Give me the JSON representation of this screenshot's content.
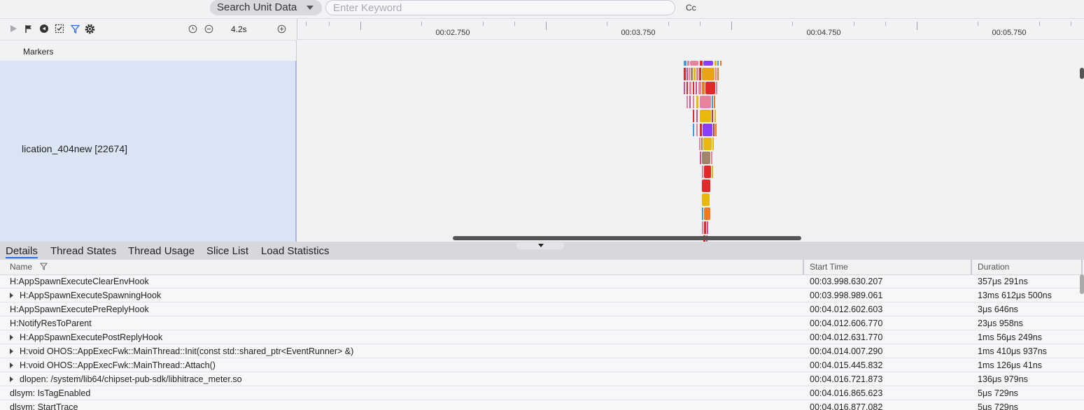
{
  "search": {
    "scope_label": "Search Unit Data",
    "placeholder": "Enter Keyword",
    "value": "",
    "case_button": "Cc"
  },
  "toolbar": {
    "icons": [
      "play-icon",
      "flag-icon",
      "marker-circle-icon",
      "capture-icon",
      "filter-icon",
      "settings-icon"
    ],
    "zoom_value": "4.2s"
  },
  "ruler": {
    "labels": [
      "00:02.750",
      "00:03.750",
      "00:04.750",
      "00:05.750"
    ]
  },
  "markers_label": "Markers",
  "process": {
    "name": "lication_404new [22674]"
  },
  "slice_colors": [
    "#e8a317",
    "#8a3ffc",
    "#e0292b",
    "#e7829b",
    "#e8b80c",
    "#f07a1e",
    "#3f9be0",
    "#a0856b",
    "#d14f8c",
    "#20a0a0"
  ],
  "tabs": [
    "Details",
    "Thread States",
    "Thread Usage",
    "Slice List",
    "Load Statistics"
  ],
  "active_tab": "Details",
  "table": {
    "headers": {
      "name": "Name",
      "start": "Start Time",
      "duration": "Duration"
    },
    "rows": [
      {
        "name": "H:AppSpawnExecuteClearEnvHook",
        "expandable": false,
        "start": "00:03.998.630.207",
        "duration": "357μs 291ns"
      },
      {
        "name": "H:AppSpawnExecuteSpawningHook",
        "expandable": true,
        "start": "00:03.998.989.061",
        "duration": "13ms 612μs 500ns"
      },
      {
        "name": "H:AppSpawnExecutePreReplyHook",
        "expandable": false,
        "start": "00:04.012.602.603",
        "duration": "3μs 646ns"
      },
      {
        "name": "H:NotifyResToParent",
        "expandable": false,
        "start": "00:04.012.606.770",
        "duration": "23μs 958ns"
      },
      {
        "name": "H:AppSpawnExecutePostReplyHook",
        "expandable": true,
        "start": "00:04.012.631.770",
        "duration": "1ms 56μs 249ns"
      },
      {
        "name": "H:void OHOS::AppExecFwk::MainThread::Init(const std::shared_ptr<EventRunner> &)",
        "expandable": true,
        "start": "00:04.014.007.290",
        "duration": "1ms 410μs 937ns"
      },
      {
        "name": "H:void OHOS::AppExecFwk::MainThread::Attach()",
        "expandable": true,
        "start": "00:04.015.445.832",
        "duration": "1ms 126μs 41ns"
      },
      {
        "name": "dlopen:  /system/lib64/chipset-pub-sdk/libhitrace_meter.so",
        "expandable": true,
        "start": "00:04.016.721.873",
        "duration": "136μs 979ns"
      },
      {
        "name": "dlsym:  IsTagEnabled",
        "expandable": false,
        "start": "00:04.016.865.623",
        "duration": "5μs 729ns"
      },
      {
        "name": "dlsym:  StartTrace",
        "expandable": false,
        "start": "00:04.016.877.082",
        "duration": "5μs 729ns"
      }
    ]
  }
}
